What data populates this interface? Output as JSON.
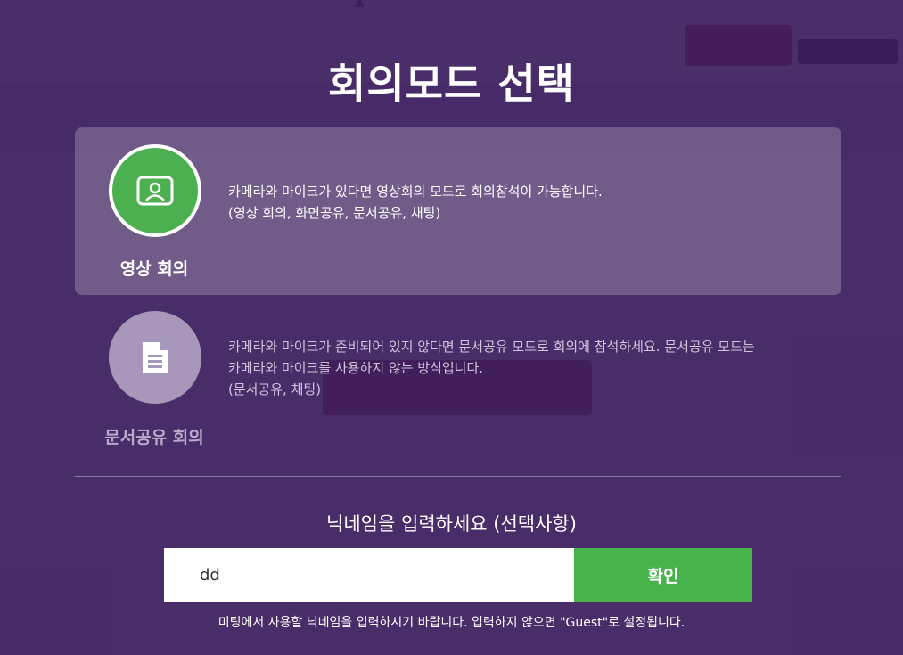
{
  "colors": {
    "overlay": "#3e2a5c",
    "selected_circle": "#4caf50",
    "unselected_circle": "#a697bb",
    "confirm_button": "#46b34b"
  },
  "modal": {
    "title": "회의모드 선택",
    "modes": [
      {
        "icon": "video-user-icon",
        "label": "영상 회의",
        "selected": true,
        "desc_line1": "카메라와 마이크가 있다면 영상회의 모드로 회의참석이 가능합니다.",
        "desc_line2": "(영상 회의, 화면공유, 문서공유, 채팅)"
      },
      {
        "icon": "document-icon",
        "label": "문서공유 회의",
        "selected": false,
        "desc_line1": "카메라와 마이크가 준비되어 있지 않다면 문서공유 모드로 회의에 참석하세요. 문서공유 모드는",
        "desc_line2": "카메라와 마이크를 사용하지 않는 방식입니다.",
        "desc_line3": "(문서공유, 채팅)"
      }
    ],
    "nickname": {
      "label": "닉네임을 입력하세요 (선택사항)",
      "value": "dd",
      "confirm_label": "확인",
      "help": "미팅에서 사용할 닉네임을 입력하시기 바랍니다. 입력하지 않으면 \"Guest\"로 설정됩니다."
    }
  }
}
